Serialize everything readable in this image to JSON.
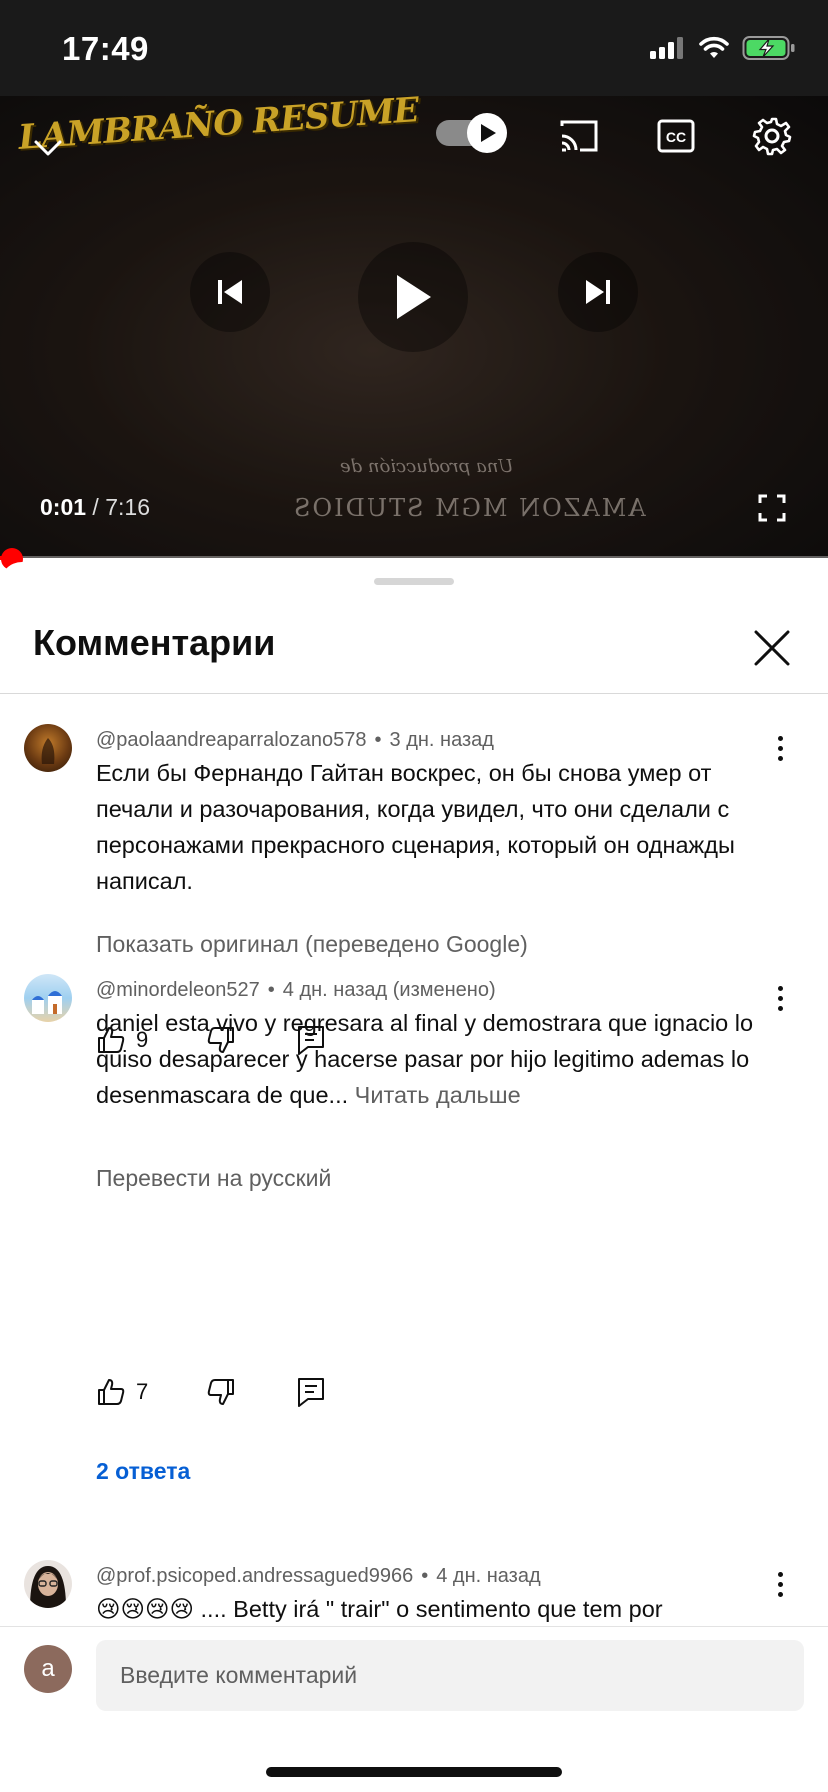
{
  "status_bar": {
    "time": "17:49",
    "icons": [
      "cellular-signal-icon",
      "wifi-icon",
      "battery-charging-icon"
    ],
    "battery_color": "#4cd964"
  },
  "player": {
    "channel_logo": "LAMBRAÑO RESUME",
    "credit_line1": "Una producción de",
    "credit_line2": "AMAZON MGM STUDIOS",
    "current_time": "0:01",
    "separator": " / ",
    "duration": "7:16",
    "progress_fraction": 0.0023,
    "autoplay_on": true,
    "icons": [
      "collapse-chevron-icon",
      "autoplay-toggle",
      "cast-icon",
      "captions-icon",
      "settings-gear-icon",
      "previous-icon",
      "play-icon",
      "next-icon",
      "fullscreen-icon"
    ],
    "progress_color": "#ff0000"
  },
  "comments_panel": {
    "title": "Комментарии",
    "close_icon": "close-icon"
  },
  "comments": [
    {
      "author": "@paolaandreaparralozano578",
      "when": "3 дн. назад",
      "text": "Если бы Фернандо Гайтан воскрес, он бы снова умер от печали и разочарования, когда увидел, что они сделали с персонажами прекрасного сценария, который он однажды написал.",
      "translate_label": "Показать оригинал (переведено Google)",
      "likes": "9"
    },
    {
      "author": "@minordeleon527",
      "when": "4 дн. назад (изменено)",
      "text": "daniel esta vivo y regresara al final y demostrara que ignacio lo quiso desaparecer y hacerse pasar por hijo legitimo ademas lo desenmascara de que...",
      "read_more": "Читать дальше",
      "translate_label": "Перевести на русский",
      "likes": "7",
      "replies_label": "2 ответа"
    },
    {
      "author": "@prof.psicoped.andressagued9966",
      "when": "4 дн. назад",
      "emoji": "😢😢😢😢",
      "text": " .... Betty irá \" trair\" o sentimento que tem por"
    }
  ],
  "composer": {
    "avatar_letter": "a",
    "placeholder": "Введите комментарий"
  }
}
